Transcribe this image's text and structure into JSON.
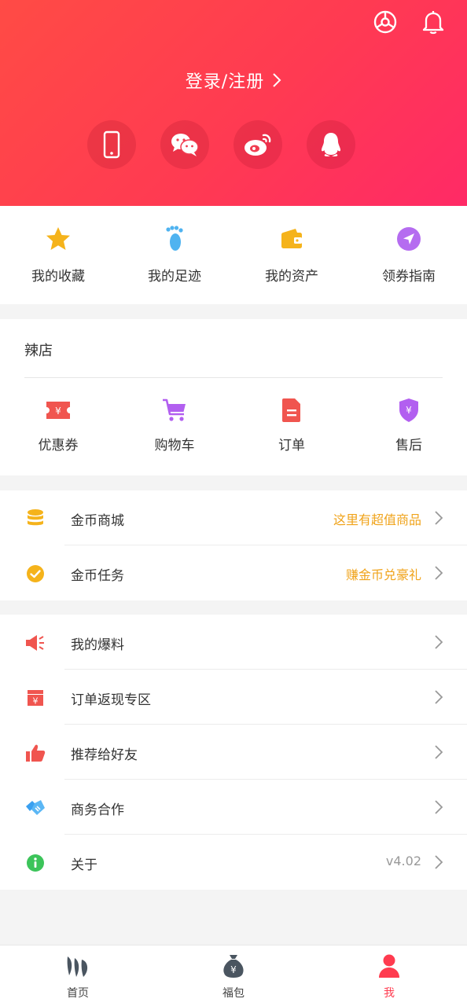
{
  "header": {
    "login_label": "登录/注册",
    "social_icons": [
      "phone-icon",
      "wechat-icon",
      "weibo-icon",
      "qq-icon"
    ]
  },
  "quick_links": [
    {
      "label": "我的收藏",
      "icon": "star-icon",
      "color": "#f5b31b"
    },
    {
      "label": "我的足迹",
      "icon": "footprint-icon",
      "color": "#4fb3f0"
    },
    {
      "label": "我的资产",
      "icon": "wallet-icon",
      "color": "#f5b31b"
    },
    {
      "label": "领券指南",
      "icon": "send-icon",
      "color": "#b56cf0"
    }
  ],
  "shop": {
    "title": "辣店",
    "items": [
      {
        "label": "优惠券",
        "icon": "coupon-icon",
        "color": "#f0554f"
      },
      {
        "label": "购物车",
        "icon": "cart-icon",
        "color": "#b25ff0"
      },
      {
        "label": "订单",
        "icon": "order-icon",
        "color": "#f0554f"
      },
      {
        "label": "售后",
        "icon": "shield-yen-icon",
        "color": "#b25ff0"
      }
    ]
  },
  "coin_group": [
    {
      "title": "金币商城",
      "extra": "这里有超值商品",
      "icon": "coins-icon",
      "color": "#f5b31b"
    },
    {
      "title": "金币任务",
      "extra": "赚金币兑豪礼",
      "icon": "check-circle-icon",
      "color": "#f5b31b"
    }
  ],
  "misc_group": [
    {
      "title": "我的爆料",
      "extra": "",
      "icon": "megaphone-icon",
      "color": "#f0554f"
    },
    {
      "title": "订单返现专区",
      "extra": "",
      "icon": "cashback-icon",
      "color": "#f0554f"
    },
    {
      "title": "推荐给好友",
      "extra": "",
      "icon": "thumbs-up-icon",
      "color": "#f0554f"
    },
    {
      "title": "商务合作",
      "extra": "",
      "icon": "handshake-icon",
      "color": "#3aa0f0"
    },
    {
      "title": "关于",
      "extra": "v4.02",
      "icon": "info-icon",
      "color": "#3cc45a"
    }
  ],
  "bottom_nav": [
    {
      "label": "首页",
      "icon": "home-icon",
      "active": false
    },
    {
      "label": "福包",
      "icon": "money-bag-icon",
      "active": false
    },
    {
      "label": "我",
      "icon": "user-icon",
      "active": true
    }
  ],
  "colors": {
    "accent": "#ff3b4f",
    "coin_text": "#f0a31a",
    "header_start": "#ff4b45",
    "header_end": "#ff2a66"
  }
}
